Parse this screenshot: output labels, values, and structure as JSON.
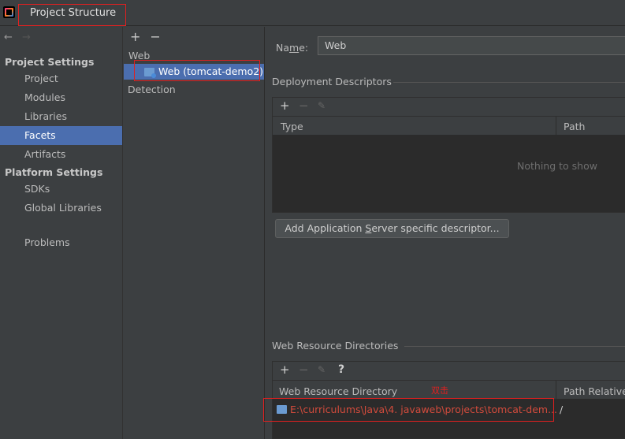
{
  "window": {
    "title": "Project Structure"
  },
  "nav": {
    "back_arrow": "←",
    "forward_arrow": "→",
    "project_settings_header": "Project Settings",
    "project_settings_items": [
      "Project",
      "Modules",
      "Libraries",
      "Facets",
      "Artifacts"
    ],
    "platform_settings_header": "Platform Settings",
    "platform_settings_items": [
      "SDKs",
      "Global Libraries"
    ],
    "problems": "Problems",
    "selected_item": "Facets"
  },
  "facets_panel": {
    "toolbar": {
      "add": "+",
      "remove": "−"
    },
    "tree": {
      "group": "Web",
      "selected_item": "Web (tomcat-demo2)",
      "detection": "Detection"
    }
  },
  "main": {
    "name_label_prefix": "Na",
    "name_label_underline": "m",
    "name_label_suffix": "e:",
    "name_value": "Web",
    "deployment": {
      "title": "Deployment Descriptors",
      "toolbar": {
        "add": "+",
        "remove": "−",
        "edit": "✎"
      },
      "columns": [
        "Type",
        "Path"
      ],
      "empty_text": "Nothing to show",
      "add_button_prefix": "Add Application ",
      "add_button_underline": "S",
      "add_button_suffix": "erver specific descriptor..."
    },
    "web_resources": {
      "title": "Web Resource Directories",
      "toolbar": {
        "add": "+",
        "remove": "−",
        "edit": "✎",
        "help": "?"
      },
      "columns": [
        "Web Resource Directory",
        "Path Relative"
      ],
      "annotation": "双击",
      "rows": [
        {
          "directory": "E:\\curriculums\\Java\\4. javaweb\\projects\\tomcat-dem...",
          "relative": "/"
        }
      ]
    }
  },
  "colors": {
    "background": "#3c3f41",
    "selection": "#4b6eaf",
    "table_bg": "#2b2b2b",
    "annotation": "#e02020",
    "error_path": "#d24b3c"
  }
}
